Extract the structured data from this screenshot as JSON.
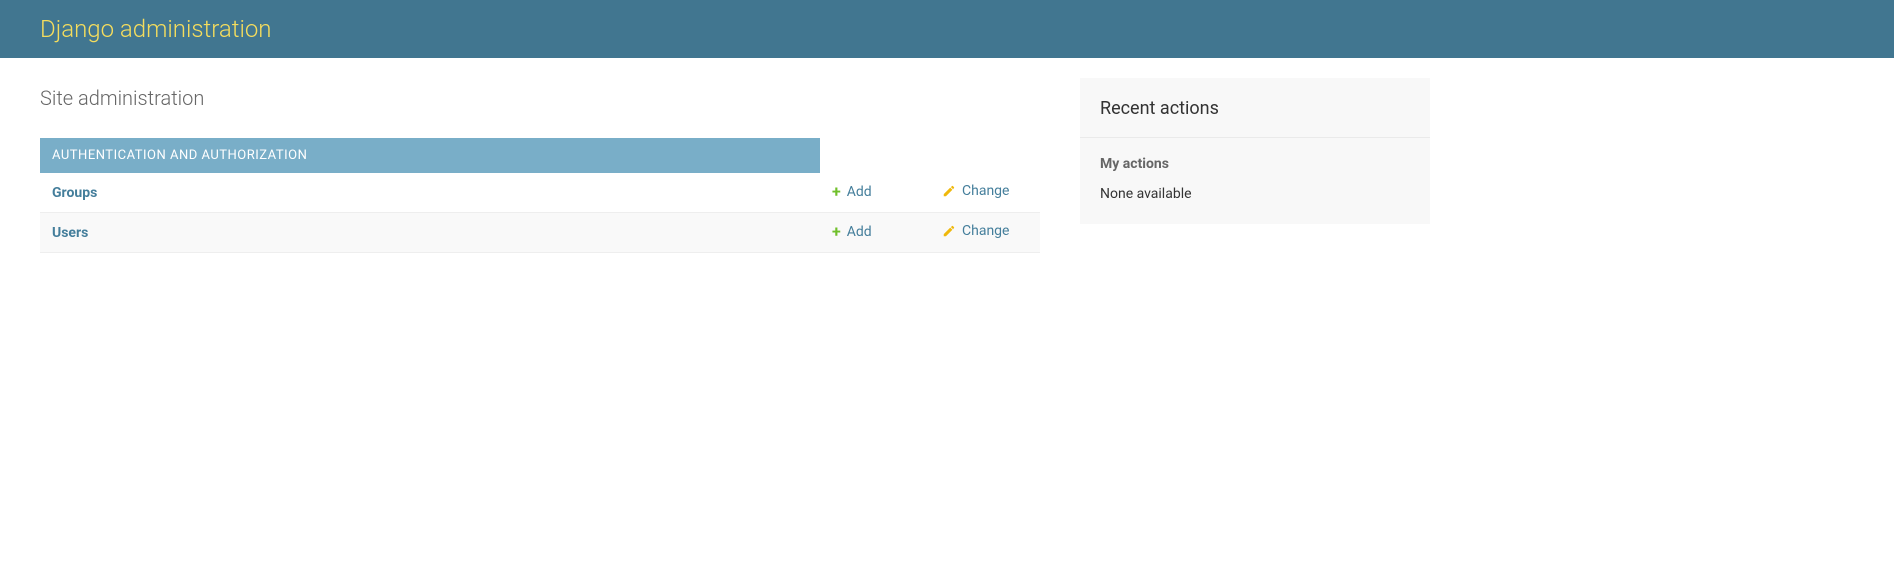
{
  "branding": {
    "title": "Django administration"
  },
  "page_title": "Site administration",
  "app_list": [
    {
      "caption": "Authentication and Authorization",
      "models": [
        {
          "name": "Groups",
          "add_label": "Add",
          "change_label": "Change"
        },
        {
          "name": "Users",
          "add_label": "Add",
          "change_label": "Change"
        }
      ]
    }
  ],
  "recent_actions": {
    "heading": "Recent actions",
    "subheading": "My actions",
    "empty_text": "None available"
  }
}
